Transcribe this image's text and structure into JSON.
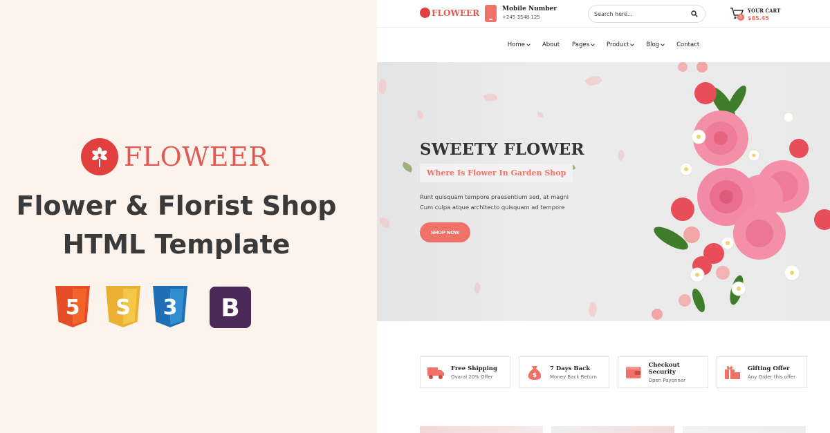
{
  "promo": {
    "brand": "FLOWEER",
    "title_line1": "Flower & Florist Shop",
    "title_line2": "HTML Template",
    "tech_icons": [
      "html5-icon",
      "css3-icon",
      "css3-icon-alt",
      "bootstrap-icon"
    ],
    "tech_colors": {
      "html5": "#e44d26",
      "sass": "#ebb032",
      "css3": "#2f8fd0",
      "bootstrap": "#4a2958"
    },
    "tech_glyphs": [
      "5",
      "S",
      "3",
      "B"
    ]
  },
  "header": {
    "brand": "FLOWEER",
    "contact_label": "Mobile Number",
    "contact_number": "+245 3548 125",
    "search_placeholder": "Search here...",
    "cart_label": "YOUR CART",
    "cart_total": "$85.45",
    "cart_count": "0"
  },
  "nav": {
    "items": [
      {
        "label": "Home",
        "dropdown": true
      },
      {
        "label": "About",
        "dropdown": false
      },
      {
        "label": "Pages",
        "dropdown": true
      },
      {
        "label": "Product",
        "dropdown": true
      },
      {
        "label": "Blog",
        "dropdown": true
      },
      {
        "label": "Contact",
        "dropdown": false
      }
    ]
  },
  "hero": {
    "title": "SWEETY FLOWER",
    "subtitle": "Where Is Flower In Garden Shop",
    "description": "Runt quisquam tempore praesentium sed, at magni Cum culpa atque architecto quisquam ad tempore",
    "button": "SHOP NOW"
  },
  "features": [
    {
      "icon": "delivery-truck-icon",
      "title": "Free Shipping",
      "subtitle": "Ovaral 20% Offer"
    },
    {
      "icon": "money-bag-icon",
      "title": "7 Days Back",
      "subtitle": "Money Back Return"
    },
    {
      "icon": "wallet-icon",
      "title": "Checkout Security",
      "subtitle": "Open Payonner"
    },
    {
      "icon": "gift-icon",
      "title": "Gifting Offer",
      "subtitle": "Any Order this offer"
    }
  ],
  "colors": {
    "accent": "#f07167",
    "brand_red": "#e2403e",
    "promo_bg": "#fcf4ec",
    "text_dark": "#3a3a3a"
  }
}
